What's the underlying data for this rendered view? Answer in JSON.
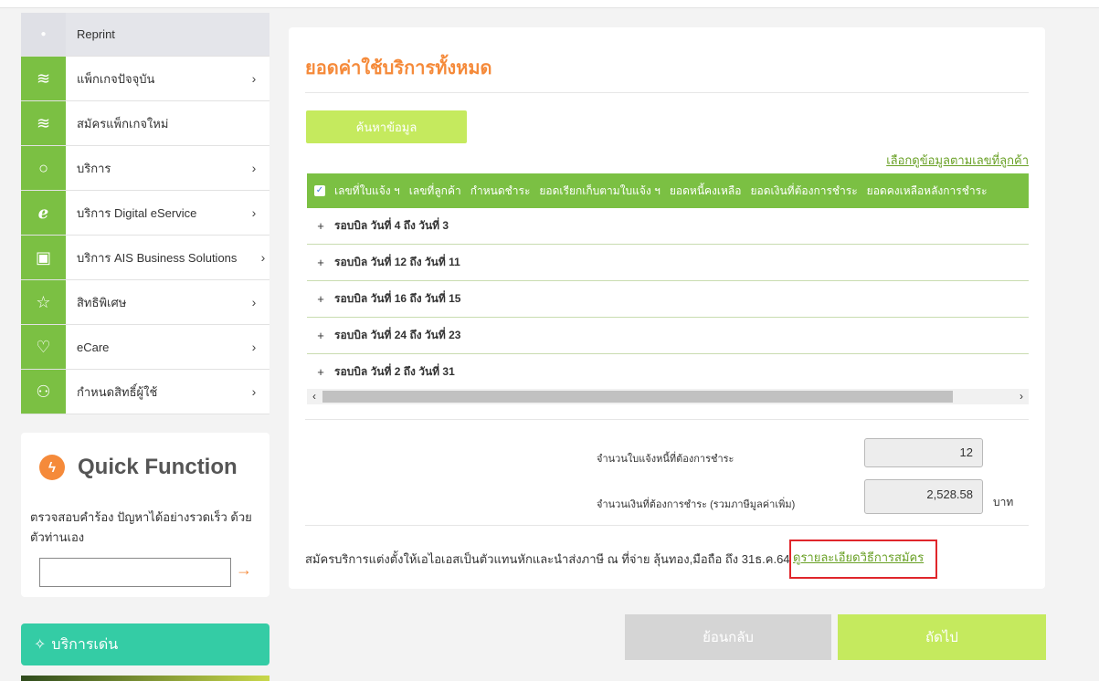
{
  "sidebar": {
    "items": [
      {
        "label": "Reprint",
        "icon": "bullet-icon",
        "chevron": ""
      },
      {
        "label": "แพ็กเกจปัจจุบัน",
        "icon": "layers-icon",
        "chevron": "›"
      },
      {
        "label": "สมัครแพ็กเกจใหม่",
        "icon": "layers-icon",
        "chevron": ""
      },
      {
        "label": "บริการ",
        "icon": "refresh-icon",
        "chevron": "›"
      },
      {
        "label": "บริการ Digital eService",
        "icon": "e-icon",
        "chevron": "›"
      },
      {
        "label": "บริการ AIS Business Solutions",
        "icon": "briefcase-icon",
        "chevron": "›"
      },
      {
        "label": "สิทธิพิเศษ",
        "icon": "star-icon",
        "chevron": "›"
      },
      {
        "label": "eCare",
        "icon": "heart-icon",
        "chevron": "›"
      },
      {
        "label": "กำหนดสิทธิ์ผู้ใช้",
        "icon": "users-icon",
        "chevron": "›"
      }
    ]
  },
  "quick_function": {
    "title": "Quick Function",
    "description": "ตรวจสอบคำร้อง ปัญหาได้อย่างรวดเร็ว ด้วยตัวท่านเอง",
    "input_value": "",
    "go_icon": "→"
  },
  "featured": {
    "label": "บริการเด่น"
  },
  "main": {
    "title": "ยอดค่าใช้บริการทั้งหมด",
    "search_button": "ค้นหาข้อมูล",
    "select_link": "เลือกดูข้อมูลตามเลขที่ลูกค้า",
    "table": {
      "headers": [
        "เลขที่ใบแจ้ง ฯ",
        "เลขที่ลูกค้า",
        "กำหนดชำระ",
        "ยอดเรียกเก็บตามใบแจ้ง ฯ",
        "ยอดหนี้คงเหลือ",
        "ยอดเงินที่ต้องการชำระ",
        "ยอดคงเหลือหลังการชำระ"
      ],
      "rows": [
        "รอบบิล วันที่ 4 ถึง วันที่ 3",
        "รอบบิล วันที่ 12 ถึง วันที่ 11",
        "รอบบิล วันที่ 16 ถึง วันที่ 15",
        "รอบบิล วันที่ 24 ถึง วันที่ 23",
        "รอบบิล วันที่ 2 ถึง วันที่ 31"
      ]
    },
    "summary": {
      "bill_count_label": "จำนวนใบแจ้งหนี้ที่ต้องการชำระ",
      "bill_count": "12",
      "amount_label": "จำนวนเงินที่ต้องการชำระ (รวมภาษีมูลค่าเพิ่ม)",
      "amount": "2,528.58",
      "unit": "บาท"
    },
    "note": "สมัครบริการแต่งตั้งให้เอไอเอสเป็นตัวแทนหักและนำส่งภาษี ณ ที่จ่าย ลุ้นทอง,มือถือ ถึง 31ธ.ค.64",
    "note_link": "ดูรายละเอียดวิธีการสมัคร",
    "back_button": "ย้อนกลับ",
    "next_button": "ถัดไป"
  },
  "colors": {
    "green": "#7bc043",
    "lime": "#c5ea5e",
    "orange": "#f58a3a",
    "teal": "#34cca5",
    "highlight": "#e0262b"
  }
}
